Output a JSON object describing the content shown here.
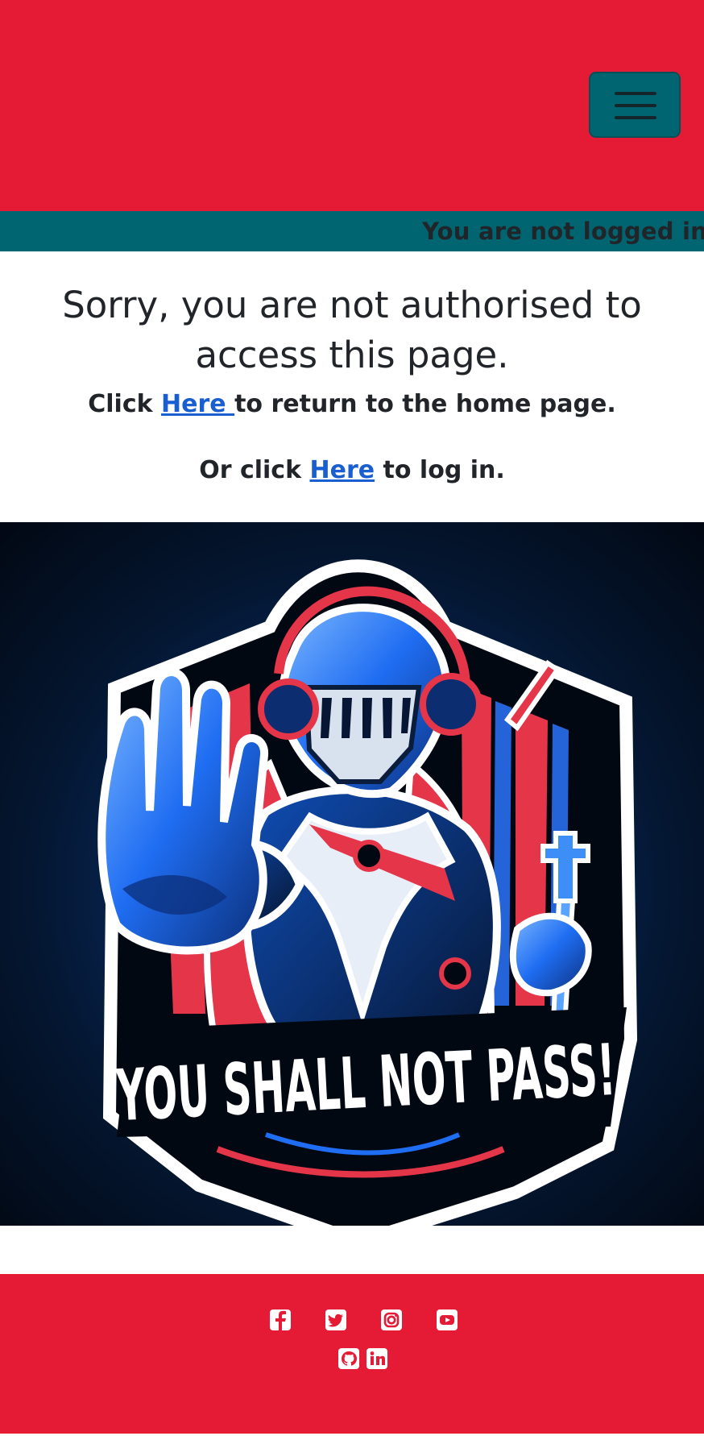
{
  "header": {
    "menu_toggle_icon": "hamburger-menu-icon"
  },
  "status_bar": {
    "text": "You are not logged in"
  },
  "message": {
    "title": "Sorry, you are not authorised to access this page.",
    "line1_prefix": "Click ",
    "line1_link": "Here ",
    "line1_suffix": "to return to the home page.",
    "line2_prefix": "Or click ",
    "line2_link": "Here",
    "line2_suffix": " to log in."
  },
  "hero": {
    "banner_text": "YOU SHALL NOT PASS!"
  },
  "footer": {
    "icons": [
      "facebook-icon",
      "twitter-icon",
      "instagram-icon",
      "youtube-icon",
      "github-icon",
      "linkedin-icon"
    ]
  },
  "colors": {
    "brand_red": "#e51b36",
    "brand_teal": "#006570",
    "text_dark": "#212529",
    "link_blue": "#1a5fd0",
    "hero_dark_blue": "#041630",
    "hero_bright_blue": "#1f6df2"
  }
}
